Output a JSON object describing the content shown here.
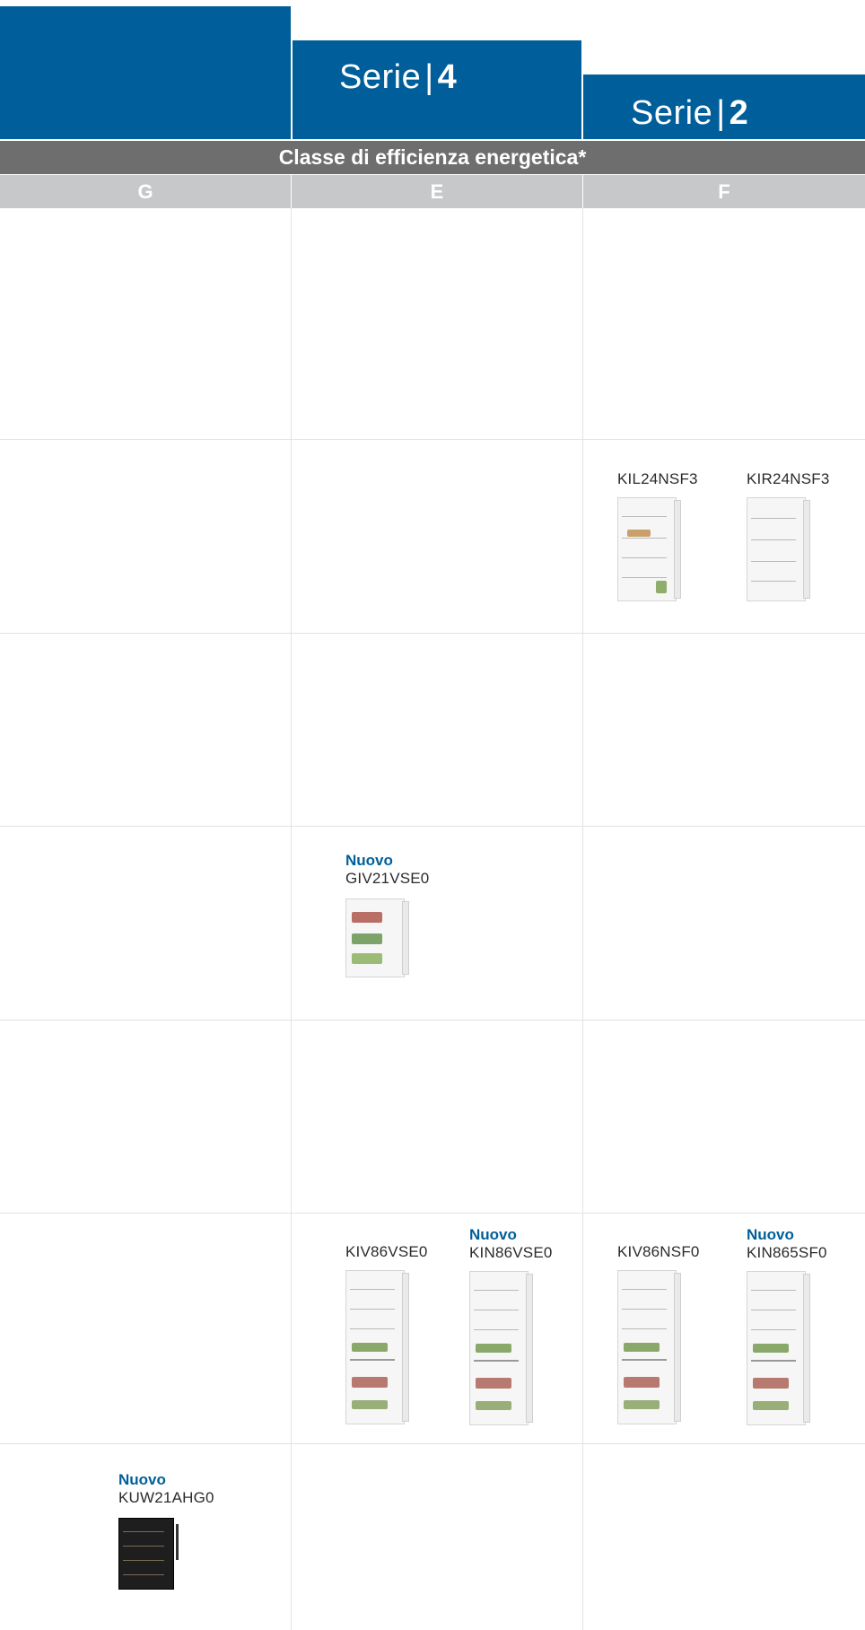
{
  "header": {
    "serie4": {
      "word": "Serie",
      "sep": "|",
      "num": "4"
    },
    "serie2": {
      "word": "Serie",
      "sep": "|",
      "num": "2"
    }
  },
  "energy_band": {
    "title": "Classe di efficienza energetica*"
  },
  "classes": [
    "G",
    "E",
    "F"
  ],
  "products": [
    {
      "badge": "",
      "model": "KIL24NSF3",
      "type": "single-door-fridge"
    },
    {
      "badge": "",
      "model": "KIR24NSF3",
      "type": "single-door-fridge"
    },
    {
      "badge": "Nuovo",
      "model": "GIV21VSE0",
      "type": "freezer"
    },
    {
      "badge": "",
      "model": "KIV86VSE0",
      "type": "fridge-freezer"
    },
    {
      "badge": "Nuovo",
      "model": "KIN86VSE0",
      "type": "fridge-freezer"
    },
    {
      "badge": "",
      "model": "KIV86NSF0",
      "type": "fridge-freezer"
    },
    {
      "badge": "Nuovo",
      "model": "KIN865SF0",
      "type": "fridge-freezer"
    },
    {
      "badge": "Nuovo",
      "model": "KUW21AHG0",
      "type": "wine-cooler"
    }
  ],
  "colors": {
    "brand_blue": "#005f9a",
    "band_gray": "#6e6e6e",
    "class_gray": "#c7c8ca"
  }
}
